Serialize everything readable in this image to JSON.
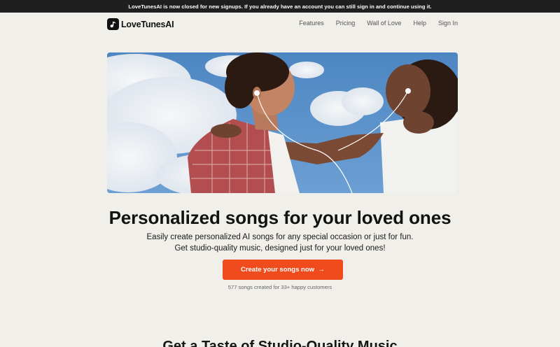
{
  "banner": {
    "text": "LoveTunesAI is now closed for new signups. If you already have an account you can still sign in and continue using it."
  },
  "header": {
    "brand": "LoveTunesAI",
    "logo_icon": "music-note-icon",
    "nav": [
      {
        "label": "Features"
      },
      {
        "label": "Pricing"
      },
      {
        "label": "Wall of Love"
      },
      {
        "label": "Help"
      },
      {
        "label": "Sign In"
      }
    ]
  },
  "hero": {
    "image_alt": "couple sharing earphones under a cloudy blue sky",
    "headline": "Personalized songs for your loved ones",
    "subline1": "Easily create personalized AI songs for any special occasion or just for fun.",
    "subline2": "Get studio-quality music, designed just for your loved ones!",
    "cta_label": "Create your songs now",
    "cta_icon": "arrow-right-icon",
    "stats": "577 songs created for 33+ happy customers"
  },
  "next_section": {
    "title": "Get a Taste of Studio-Quality Music"
  },
  "colors": {
    "background": "#f1efea",
    "banner": "#1f1f1f",
    "accent": "#f04b1d"
  }
}
